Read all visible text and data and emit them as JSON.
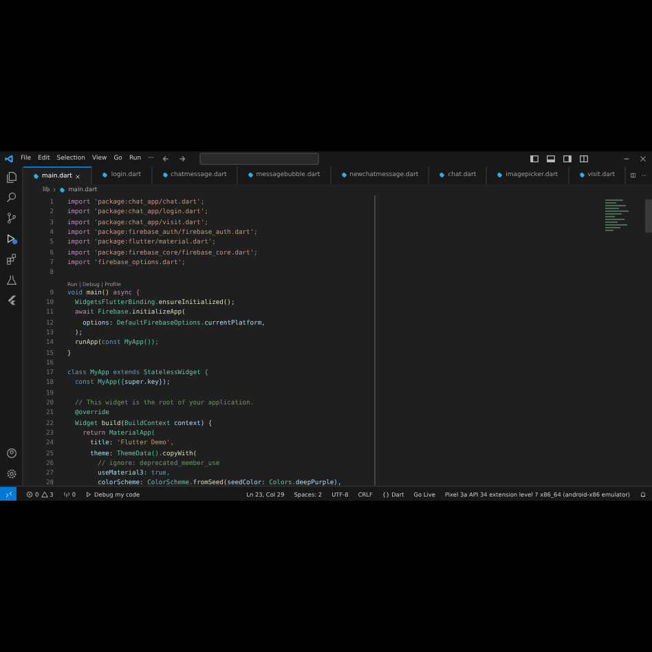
{
  "menu": [
    "File",
    "Edit",
    "Selection",
    "View",
    "Go",
    "Run",
    "···"
  ],
  "tabs": [
    {
      "label": "main.dart",
      "selected": true
    },
    {
      "label": "login.dart",
      "selected": false
    },
    {
      "label": "chatmessage.dart",
      "selected": false
    },
    {
      "label": "messagebubble.dart",
      "selected": false
    },
    {
      "label": "newchatmessage.dart",
      "selected": false
    },
    {
      "label": "chat.dart",
      "selected": false
    },
    {
      "label": "imagepicker.dart",
      "selected": false
    },
    {
      "label": "visit.dart",
      "selected": false
    }
  ],
  "breadcrumb": [
    "lib",
    "main.dart"
  ],
  "lines": [
    {
      "kind": "code",
      "number": "1",
      "tokens": [
        {
          "text": "import ",
          "kind": "control"
        },
        {
          "text": "'package:chat_app/chat.dart';",
          "kind": "string"
        }
      ]
    },
    {
      "kind": "code",
      "number": "2",
      "tokens": [
        {
          "text": "import ",
          "kind": "control"
        },
        {
          "text": "'package:chat_app/login.dart';",
          "kind": "string"
        }
      ]
    },
    {
      "kind": "code",
      "number": "3",
      "tokens": [
        {
          "text": "import ",
          "kind": "control"
        },
        {
          "text": "'package:chat_app/visit.dart';",
          "kind": "string"
        }
      ]
    },
    {
      "kind": "code",
      "number": "4",
      "tokens": [
        {
          "text": "import ",
          "kind": "control"
        },
        {
          "text": "'package:firebase_auth/firebase_auth.dart';",
          "kind": "string"
        }
      ]
    },
    {
      "kind": "code",
      "number": "5",
      "tokens": [
        {
          "text": "import ",
          "kind": "control"
        },
        {
          "text": "'package:flutter/material.dart';",
          "kind": "string"
        }
      ]
    },
    {
      "kind": "code",
      "number": "6",
      "tokens": [
        {
          "text": "import ",
          "kind": "control"
        },
        {
          "text": "'package:firebase_core/firebase_core.dart';",
          "kind": "string"
        }
      ]
    },
    {
      "kind": "code",
      "number": "7",
      "tokens": [
        {
          "text": "import ",
          "kind": "control"
        },
        {
          "text": "'firebase_options.dart';",
          "kind": "string"
        }
      ]
    },
    {
      "kind": "code",
      "number": "8"
    },
    {
      "kind": "codelens",
      "text": "Run | Debug | Profile"
    },
    {
      "kind": "code",
      "number": "9",
      "tokens": [
        {
          "text": "void ",
          "kind": "keyword"
        },
        {
          "text": "main() ",
          "kind": "func"
        },
        {
          "text": "async {",
          "kind": "control"
        }
      ]
    },
    {
      "kind": "code",
      "number": "10",
      "tokens": [
        {
          "text": "  WidgetsFlutterBinding.",
          "kind": "type"
        },
        {
          "text": "ensureInitialized();",
          "kind": "func"
        }
      ]
    },
    {
      "kind": "code",
      "number": "11",
      "tokens": [
        {
          "text": "  await ",
          "kind": "control"
        },
        {
          "text": "Firebase.",
          "kind": "type"
        },
        {
          "text": "initializeApp(",
          "kind": "func"
        }
      ]
    },
    {
      "kind": "code",
      "number": "12",
      "tokens": [
        {
          "text": "    options: ",
          "kind": "var"
        },
        {
          "text": "DefaultFirebaseOptions.",
          "kind": "type"
        },
        {
          "text": "currentPlatform,",
          "kind": "var"
        }
      ]
    },
    {
      "kind": "code",
      "number": "13",
      "tokens": [
        {
          "text": "  );",
          "kind": "plain"
        }
      ]
    },
    {
      "kind": "code",
      "number": "14",
      "tokens": [
        {
          "text": "  runApp(",
          "kind": "func"
        },
        {
          "text": "const ",
          "kind": "keyword"
        },
        {
          "text": "MyApp());",
          "kind": "type"
        }
      ]
    },
    {
      "kind": "code",
      "number": "15",
      "tokens": [
        {
          "text": "}",
          "kind": "plain"
        }
      ]
    },
    {
      "kind": "code",
      "number": "16"
    },
    {
      "kind": "code",
      "number": "17",
      "tokens": [
        {
          "text": "class ",
          "kind": "keyword"
        },
        {
          "text": "MyApp ",
          "kind": "type"
        },
        {
          "text": "extends ",
          "kind": "keyword"
        },
        {
          "text": "StatelessWidget {",
          "kind": "type"
        }
      ]
    },
    {
      "kind": "code",
      "number": "18",
      "tokens": [
        {
          "text": "  const ",
          "kind": "keyword"
        },
        {
          "text": "MyApp({",
          "kind": "type"
        },
        {
          "text": "super.key});",
          "kind": "var"
        }
      ]
    },
    {
      "kind": "code",
      "number": "19"
    },
    {
      "kind": "code",
      "number": "20",
      "tokens": [
        {
          "text": "  // This widget is the root of your application.",
          "kind": "comment"
        }
      ]
    },
    {
      "kind": "code",
      "number": "21",
      "tokens": [
        {
          "text": "  @override",
          "kind": "type"
        }
      ]
    },
    {
      "kind": "code",
      "number": "22",
      "tokens": [
        {
          "text": "  Widget ",
          "kind": "type"
        },
        {
          "text": "build(",
          "kind": "func"
        },
        {
          "text": "BuildContext ",
          "kind": "type"
        },
        {
          "text": "context) {",
          "kind": "var"
        }
      ]
    },
    {
      "kind": "code",
      "number": "23",
      "tokens": [
        {
          "text": "    return ",
          "kind": "control"
        },
        {
          "text": "MaterialApp(",
          "kind": "type"
        }
      ]
    },
    {
      "kind": "code",
      "number": "24",
      "tokens": [
        {
          "text": "      title: ",
          "kind": "var"
        },
        {
          "text": "'Flutter Demo',",
          "kind": "string"
        }
      ]
    },
    {
      "kind": "code",
      "number": "25",
      "tokens": [
        {
          "text": "      theme: ",
          "kind": "var"
        },
        {
          "text": "ThemeData().",
          "kind": "type"
        },
        {
          "text": "copyWith(",
          "kind": "func"
        }
      ]
    },
    {
      "kind": "code",
      "number": "26",
      "tokens": [
        {
          "text": "        // ignore: deprecated_member_use",
          "kind": "comment"
        }
      ]
    },
    {
      "kind": "code",
      "number": "27",
      "tokens": [
        {
          "text": "        useMaterial3: ",
          "kind": "var"
        },
        {
          "text": "true,",
          "kind": "keyword"
        }
      ]
    },
    {
      "kind": "code",
      "number": "28",
      "tokens": [
        {
          "text": "        colorScheme: ",
          "kind": "var"
        },
        {
          "text": "ColorScheme.",
          "kind": "type"
        },
        {
          "text": "fromSeed(",
          "kind": "func"
        },
        {
          "text": "seedColor: ",
          "kind": "var"
        },
        {
          "text": "Colors.",
          "kind": "type"
        },
        {
          "text": "deepPurple),",
          "kind": "var"
        }
      ]
    }
  ],
  "status": {
    "errors": "0",
    "warnings": "3",
    "ports": "0",
    "debug": "Debug my code",
    "right": [
      "Ln 23, Col 29",
      "Spaces: 2",
      "UTF-8",
      "CRLF",
      "{} Dart",
      "Go Live",
      "Pixel 3a API 34 extension level 7 x86_64 (android-x86 emulator)"
    ]
  }
}
